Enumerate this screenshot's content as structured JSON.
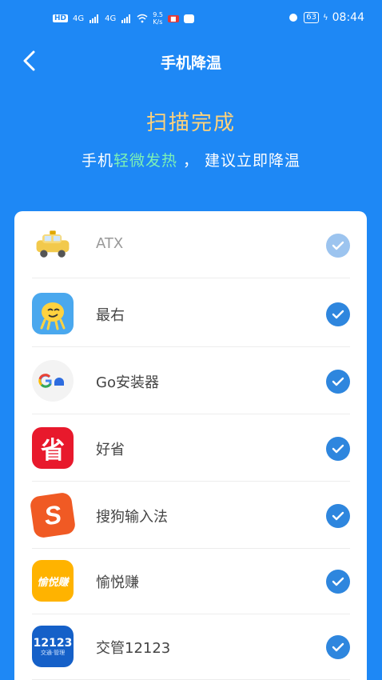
{
  "status": {
    "hd": "HD",
    "net1": "4G",
    "net2": "4G",
    "speed": "9.5",
    "speed_unit": "K/s",
    "battery": "63",
    "time": "08:44"
  },
  "nav": {
    "title": "手机降温"
  },
  "scan": {
    "title": "扫描完成",
    "subtitle_prefix": "手机",
    "subtitle_highlight": "轻微发热",
    "subtitle_suffix": " ， 建议立即降温"
  },
  "apps": [
    {
      "name": "ATX",
      "icon": "taxi-icon"
    },
    {
      "name": "最右",
      "icon": "zuiyou-icon"
    },
    {
      "name": "Go安装器",
      "icon": "google-go-icon"
    },
    {
      "name": "好省",
      "icon": "haosheng-icon"
    },
    {
      "name": "搜狗输入法",
      "icon": "sogou-icon"
    },
    {
      "name": "愉悦赚",
      "icon": "yuyuezhuan-icon"
    },
    {
      "name": "交管12123",
      "icon": "jiaoguan-icon"
    }
  ],
  "icon_text": {
    "yuyue": "愉悦赚",
    "jg_top": "12123",
    "jg_bottom": "交通·管理",
    "sogou": "S",
    "haosheng": "省"
  },
  "colors": {
    "background": "#1e88f5",
    "title_gold": "#ffd27a",
    "highlight_green": "#7cf0b4",
    "check_blue": "#2e86de"
  }
}
